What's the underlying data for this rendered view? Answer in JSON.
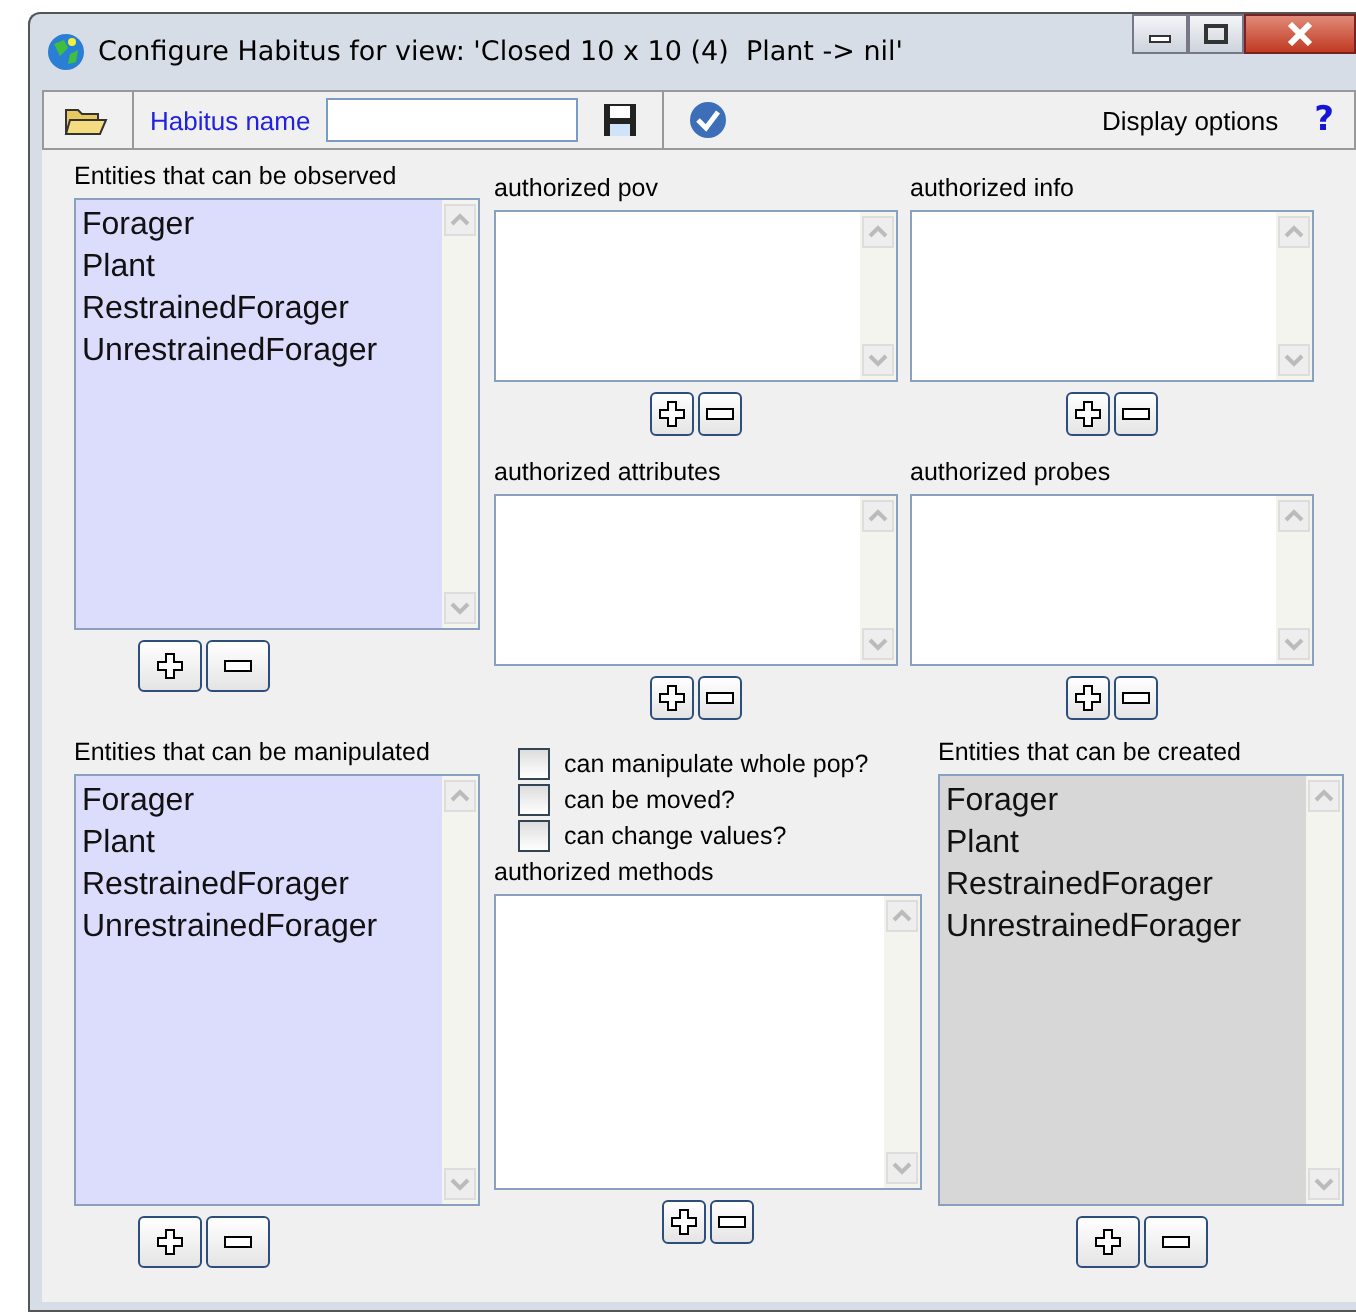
{
  "window": {
    "title": "Configure Habitus for view: 'Closed 10 x 10 (4)  Plant -> nil'"
  },
  "toolbar": {
    "name_label": "Habitus name",
    "display_options": "Display options",
    "help": "?"
  },
  "observed": {
    "label": "Entities that can be observed",
    "disabled": false,
    "items": [
      "Forager",
      "Plant",
      "RestrainedForager",
      "UnrestrainedForager"
    ]
  },
  "authorized": [
    {
      "label": "authorized pov"
    },
    {
      "label": "authorized info"
    },
    {
      "label": "authorized attributes"
    },
    {
      "label": "authorized probes"
    }
  ],
  "manipulated": {
    "label": "Entities that can be manipulated",
    "disabled": false,
    "items": [
      "Forager",
      "Plant",
      "RestrainedForager",
      "UnrestrainedForager"
    ]
  },
  "options": [
    {
      "label": "can manipulate whole pop?",
      "checked": false
    },
    {
      "label": "can be moved?",
      "checked": false
    },
    {
      "label": "can change values?",
      "checked": false
    }
  ],
  "methods": {
    "label": "authorized methods"
  },
  "created": {
    "label": "Entities that can be created",
    "disabled": true,
    "items": [
      "Forager",
      "Plant",
      "RestrainedForager",
      "UnrestrainedForager"
    ]
  }
}
